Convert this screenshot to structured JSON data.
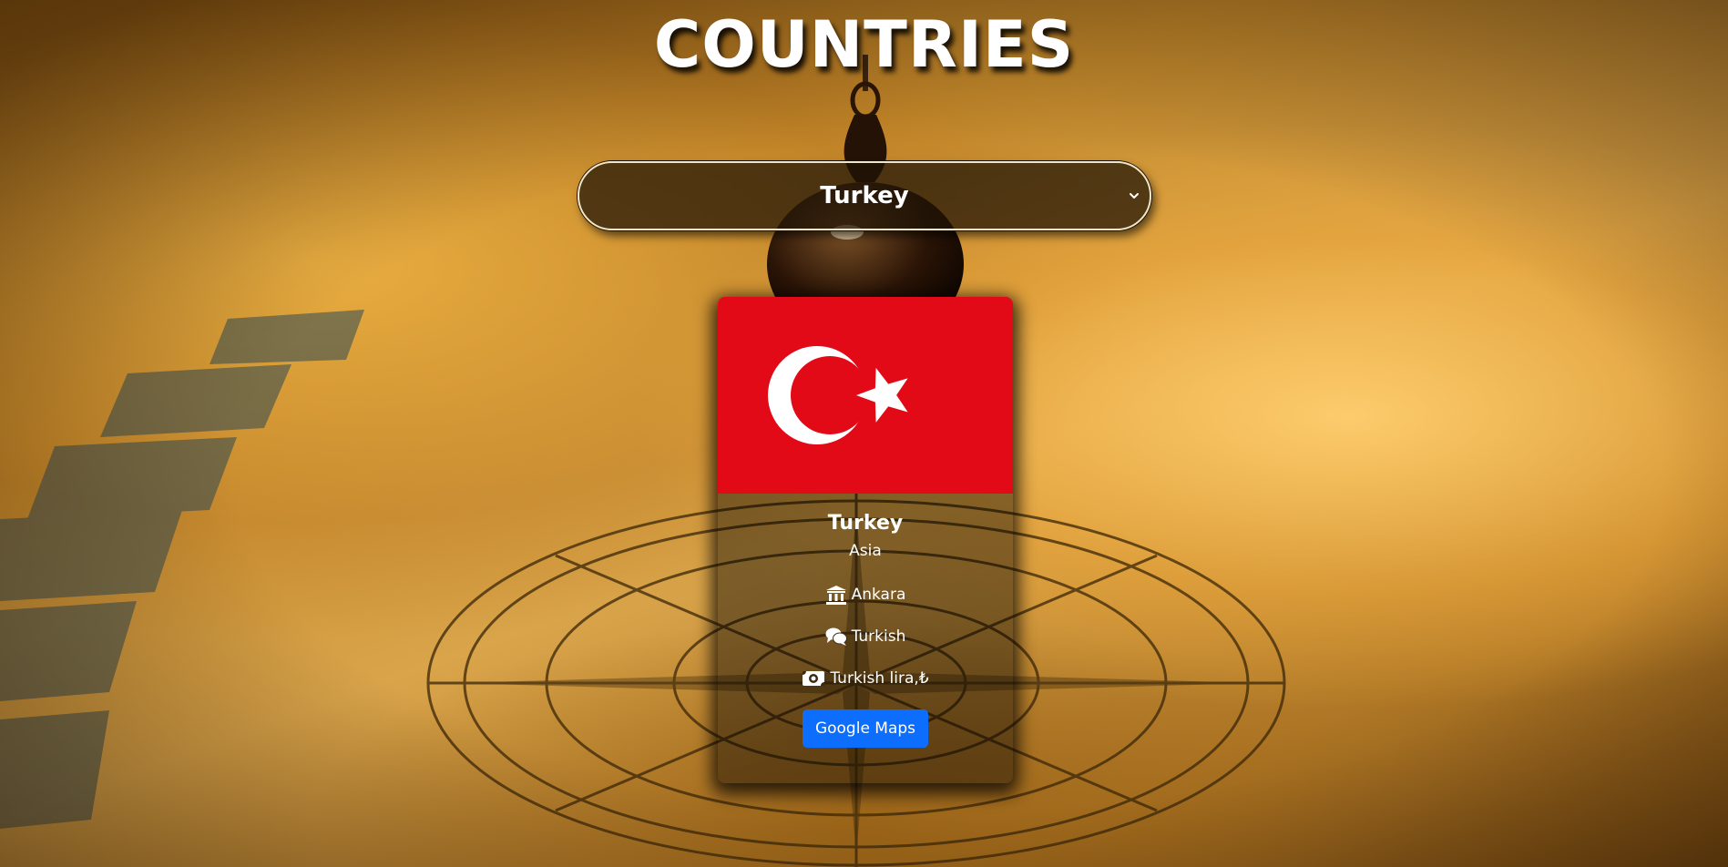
{
  "header": {
    "title": "COUNTRIES"
  },
  "country_select": {
    "selected": "Turkey",
    "icon": "chevron-down-icon"
  },
  "country_card": {
    "flag_icon": "turkey-flag",
    "flag_colors": {
      "red": "#e30a17",
      "white": "#ffffff"
    },
    "name": "Turkey",
    "region": "Asia",
    "capital": {
      "icon": "landmark-icon",
      "value": "Ankara"
    },
    "language": {
      "icon": "comments-icon",
      "value": "Turkish"
    },
    "currency": {
      "icon": "money-bill-icon",
      "value": "Turkish lira,₺"
    },
    "maps_button": {
      "label": "Google Maps",
      "color": "#0d6efd"
    }
  }
}
